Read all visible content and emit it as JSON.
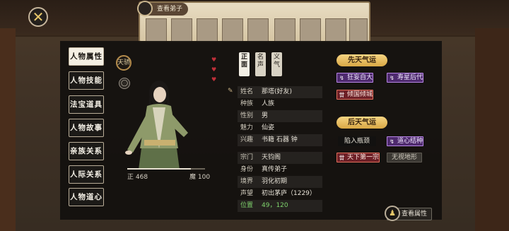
{
  "strip": {
    "title": "查看弟子"
  },
  "menu": [
    {
      "label": "人物属性",
      "active": true
    },
    {
      "label": "人物技能",
      "active": false
    },
    {
      "label": "法宝道具",
      "active": false
    },
    {
      "label": "人物故事",
      "active": false
    },
    {
      "label": "亲族关系",
      "active": false
    },
    {
      "label": "人际关系",
      "active": false
    },
    {
      "label": "人物道心",
      "active": false
    }
  ],
  "seal": {
    "label": "天骄",
    "small": "◯"
  },
  "stats": {
    "zheng": "正 468",
    "mo": "魔 100",
    "zheng_fraction": 0.82
  },
  "vtabs": [
    {
      "label": "正面",
      "active": true
    },
    {
      "label": "名声",
      "active": false
    },
    {
      "label": "义气",
      "active": false
    }
  ],
  "info": [
    {
      "key": "姓名",
      "value": "那塔(好友)"
    },
    {
      "key": "种族",
      "value": "人族"
    },
    {
      "key": "性别",
      "value": "男"
    },
    {
      "key": "魅力",
      "value": "仙姿"
    },
    {
      "key": "兴趣",
      "value": "书籍    石器   钟"
    },
    {
      "key": "宗门",
      "value": "天钧阁"
    },
    {
      "key": "身份",
      "value": "真传弟子"
    },
    {
      "key": "境界",
      "value": "羽化初期"
    },
    {
      "key": "声望",
      "value": "初出茅庐（1229）"
    },
    {
      "key": "位置",
      "value": "49，120"
    }
  ],
  "innate": {
    "title": "先天气运",
    "tags": [
      {
        "label": "狂妄自大",
        "color": "purple",
        "icon": "↯"
      },
      {
        "label": "寿星后代",
        "color": "purple",
        "icon": "↯"
      },
      {
        "label": "倾国倾城",
        "color": "red",
        "icon": "丗"
      }
    ]
  },
  "acquired": {
    "title": "后天气运",
    "tags": [
      {
        "label": "陷入瓶颈",
        "color": "dark",
        "icon": ""
      },
      {
        "label": "道心结种",
        "color": "purple",
        "icon": "↯"
      },
      {
        "label": "天下第一宗",
        "color": "red",
        "icon": "丗"
      },
      {
        "label": "无视地形",
        "color": "plain",
        "icon": ""
      }
    ]
  },
  "view_button": "查看属性",
  "close_symbol": "✕",
  "colors": {
    "gold": "#e8c86a",
    "purple": "#b785e6",
    "red": "#e4705c",
    "green": "#7ed36c"
  }
}
